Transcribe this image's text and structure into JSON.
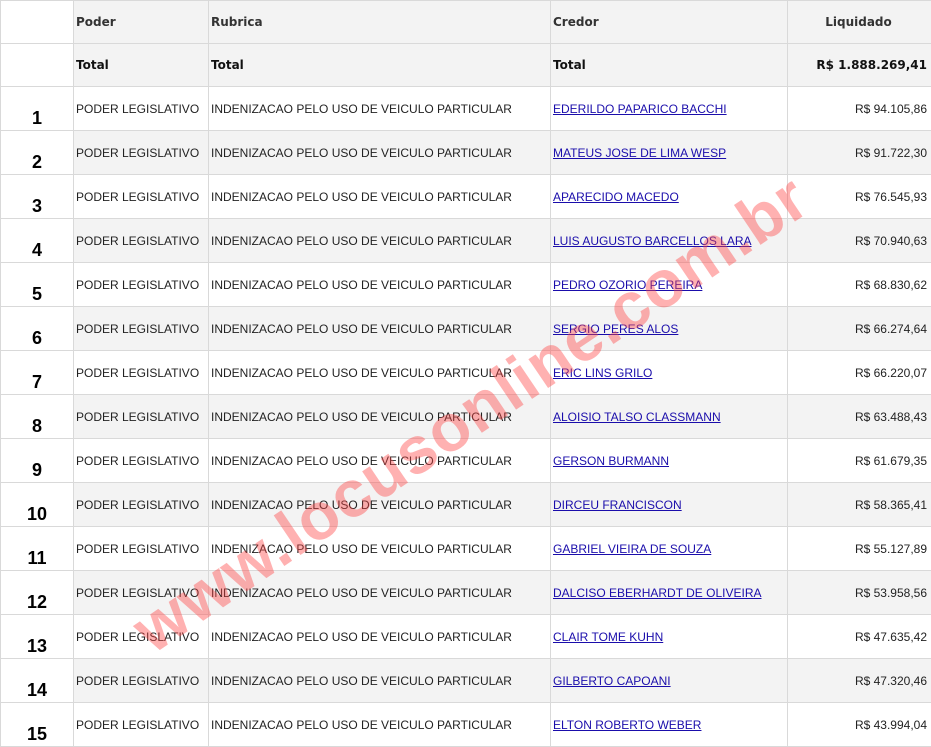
{
  "table": {
    "headers": {
      "poder": "Poder",
      "rubrica": "Rubrica",
      "credor": "Credor",
      "liquidado": "Liquidado"
    },
    "total": {
      "poder": "Total",
      "rubrica": "Total",
      "credor": "Total",
      "liquidado": "R$ 1.888.269,41"
    },
    "rows": [
      {
        "index": "1",
        "poder": "PODER LEGISLATIVO",
        "rubrica": "INDENIZACAO PELO USO DE VEICULO PARTICULAR",
        "credor": "EDERILDO PAPARICO BACCHI",
        "liquidado": "R$ 94.105,86"
      },
      {
        "index": "2",
        "poder": "PODER LEGISLATIVO",
        "rubrica": "INDENIZACAO PELO USO DE VEICULO PARTICULAR",
        "credor": "MATEUS JOSE DE LIMA WESP",
        "liquidado": "R$ 91.722,30"
      },
      {
        "index": "3",
        "poder": "PODER LEGISLATIVO",
        "rubrica": "INDENIZACAO PELO USO DE VEICULO PARTICULAR",
        "credor": "APARECIDO MACEDO",
        "liquidado": "R$ 76.545,93"
      },
      {
        "index": "4",
        "poder": "PODER LEGISLATIVO",
        "rubrica": "INDENIZACAO PELO USO DE VEICULO PARTICULAR",
        "credor": "LUIS AUGUSTO BARCELLOS LARA",
        "liquidado": "R$ 70.940,63"
      },
      {
        "index": "5",
        "poder": "PODER LEGISLATIVO",
        "rubrica": "INDENIZACAO PELO USO DE VEICULO PARTICULAR",
        "credor": "PEDRO OZORIO PEREIRA",
        "liquidado": "R$ 68.830,62"
      },
      {
        "index": "6",
        "poder": "PODER LEGISLATIVO",
        "rubrica": "INDENIZACAO PELO USO DE VEICULO PARTICULAR",
        "credor": "SERGIO PERES ALOS",
        "liquidado": "R$ 66.274,64"
      },
      {
        "index": "7",
        "poder": "PODER LEGISLATIVO",
        "rubrica": "INDENIZACAO PELO USO DE VEICULO PARTICULAR",
        "credor": "ERIC LINS GRILO",
        "liquidado": "R$ 66.220,07"
      },
      {
        "index": "8",
        "poder": "PODER LEGISLATIVO",
        "rubrica": "INDENIZACAO PELO USO DE VEICULO PARTICULAR",
        "credor": "ALOISIO TALSO CLASSMANN",
        "liquidado": "R$ 63.488,43"
      },
      {
        "index": "9",
        "poder": "PODER LEGISLATIVO",
        "rubrica": "INDENIZACAO PELO USO DE VEICULO PARTICULAR",
        "credor": "GERSON BURMANN",
        "liquidado": "R$ 61.679,35"
      },
      {
        "index": "10",
        "poder": "PODER LEGISLATIVO",
        "rubrica": "INDENIZACAO PELO USO DE VEICULO PARTICULAR",
        "credor": "DIRCEU FRANCISCON",
        "liquidado": "R$ 58.365,41"
      },
      {
        "index": "11",
        "poder": "PODER LEGISLATIVO",
        "rubrica": "INDENIZACAO PELO USO DE VEICULO PARTICULAR",
        "credor": "GABRIEL VIEIRA DE SOUZA",
        "liquidado": "R$ 55.127,89"
      },
      {
        "index": "12",
        "poder": "PODER LEGISLATIVO",
        "rubrica": "INDENIZACAO PELO USO DE VEICULO PARTICULAR",
        "credor": "DALCISO EBERHARDT DE OLIVEIRA",
        "liquidado": "R$ 53.958,56"
      },
      {
        "index": "13",
        "poder": "PODER LEGISLATIVO",
        "rubrica": "INDENIZACAO PELO USO DE VEICULO PARTICULAR",
        "credor": "CLAIR TOME KUHN",
        "liquidado": "R$ 47.635,42"
      },
      {
        "index": "14",
        "poder": "PODER LEGISLATIVO",
        "rubrica": "INDENIZACAO PELO USO DE VEICULO PARTICULAR",
        "credor": "GILBERTO CAPOANI",
        "liquidado": "R$ 47.320,46"
      },
      {
        "index": "15",
        "poder": "PODER LEGISLATIVO",
        "rubrica": "INDENIZACAO PELO USO DE VEICULO PARTICULAR",
        "credor": "ELTON ROBERTO WEBER",
        "liquidado": "R$ 43.994,04"
      }
    ]
  },
  "watermark": {
    "text": "www.locusonline.com.br",
    "color": "#ff4646"
  },
  "colors": {
    "link": "#1a0dab",
    "header_bg": "#f3f3f3",
    "selection_accent": "#1e88e5"
  }
}
